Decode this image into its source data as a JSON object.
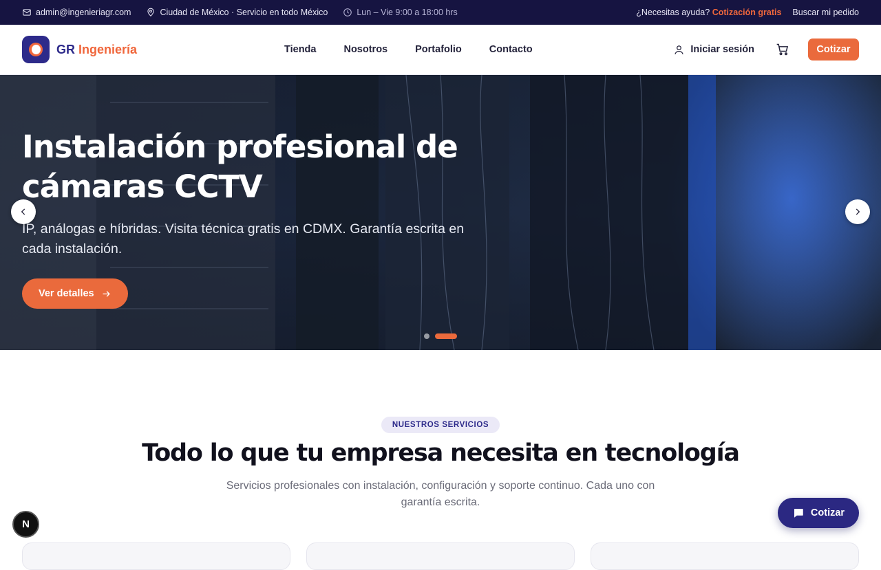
{
  "topbar": {
    "email": "admin@ingenieriagr.com",
    "location": "Ciudad de México · Servicio en todo México",
    "hours": "Lun – Vie 9:00 a 18:00 hrs",
    "help_text": "¿Necesitas ayuda?",
    "free_quote": "Cotización gratis",
    "track_order": "Buscar mi pedido"
  },
  "header": {
    "logo_primary": "GR",
    "logo_accent": "Ingeniería",
    "nav": [
      "Tienda",
      "Nosotros",
      "Portafolio",
      "Contacto"
    ],
    "login": "Iniciar sesión",
    "cta": "Cotizar"
  },
  "hero": {
    "title": "Instalación profesional de cámaras CCTV",
    "subtitle": "IP, análogas e híbridas. Visita técnica gratis en CDMX. Garantía escrita en cada instalación.",
    "button": "Ver detalles",
    "slides_total": 2,
    "active_slide": 2
  },
  "services": {
    "badge": "NUESTROS SERVICIOS",
    "title": "Todo lo que tu empresa necesita en tecnología",
    "subtitle": "Servicios profesionales con instalación, configuración y soporte continuo. Cada uno con garantía escrita."
  },
  "floating": {
    "dev_badge": "N",
    "quote_button": "Cotizar"
  },
  "colors": {
    "brand": "#2d2a8a",
    "accent": "#ea6a3c",
    "topbar_bg": "#161441"
  }
}
